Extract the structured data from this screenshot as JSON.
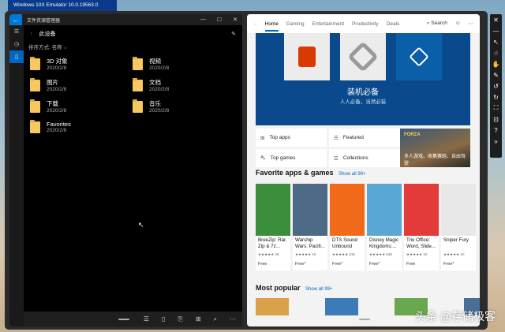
{
  "emulator": {
    "title": "Windows 10X Emulator 10.0.19563.0 (Preview)"
  },
  "explorer": {
    "title": "文件资源管理器",
    "back_icon": "back-arrow-icon",
    "location": "此设备",
    "sort_label": "排序方式: 名称 ⌵",
    "items": [
      {
        "name": "3D 对象",
        "date": "2020/2/8"
      },
      {
        "name": "视频",
        "date": "2020/2/8"
      },
      {
        "name": "图片",
        "date": "2020/2/8"
      },
      {
        "name": "文档",
        "date": "2020/2/8"
      },
      {
        "name": "下载",
        "date": "2020/2/8"
      },
      {
        "name": "音乐",
        "date": "2020/2/8"
      },
      {
        "name": "Favorites",
        "date": "2020/2/8"
      }
    ]
  },
  "store": {
    "tabs": [
      "Home",
      "Gaming",
      "Entertainment",
      "Productivity",
      "Deals"
    ],
    "active_tab": "Home",
    "search_label": "Search",
    "hero": {
      "title": "装机必备",
      "subtitle": "人人必备，当然必装"
    },
    "quick_links": [
      "Top apps",
      "Featured",
      "Top games",
      "Collections"
    ],
    "ad": {
      "brand": "FORZA",
      "text": "多人游戏、收集赛跑、自由驾驶"
    },
    "favorites": {
      "title": "Favorite apps & games",
      "show_all": "Show all 99+",
      "items": [
        {
          "name": "BreeZip: Rar, Zip & 7z...",
          "rating": "★★★★★ 2K",
          "price": "Free",
          "color": "#3b8f3b"
        },
        {
          "name": "Warship Wars: Pacifi...",
          "rating": "★★★★★ 1K",
          "price": "Free*",
          "color": "#4d6b86"
        },
        {
          "name": "DTS Sound Unbound",
          "rating": "★★★★★ 216",
          "price": "Free*",
          "color": "#f06a1a"
        },
        {
          "name": "Disney Magic Kingdoms:...",
          "rating": "★★★★★ 645",
          "price": "Free*",
          "color": "#5aa7d6"
        },
        {
          "name": "Trio Office: Word, Slide...",
          "rating": "★★★★★ 1K",
          "price": "Free",
          "color": "#e33a3a"
        },
        {
          "name": "Sniper Fury",
          "rating": "★★★★★ 1K",
          "price": "Free*",
          "color": "#e8e8e8"
        }
      ]
    },
    "popular": {
      "title": "Most popular",
      "show_all": "Show all 99+"
    }
  },
  "watermark": "头条 @存储极客"
}
